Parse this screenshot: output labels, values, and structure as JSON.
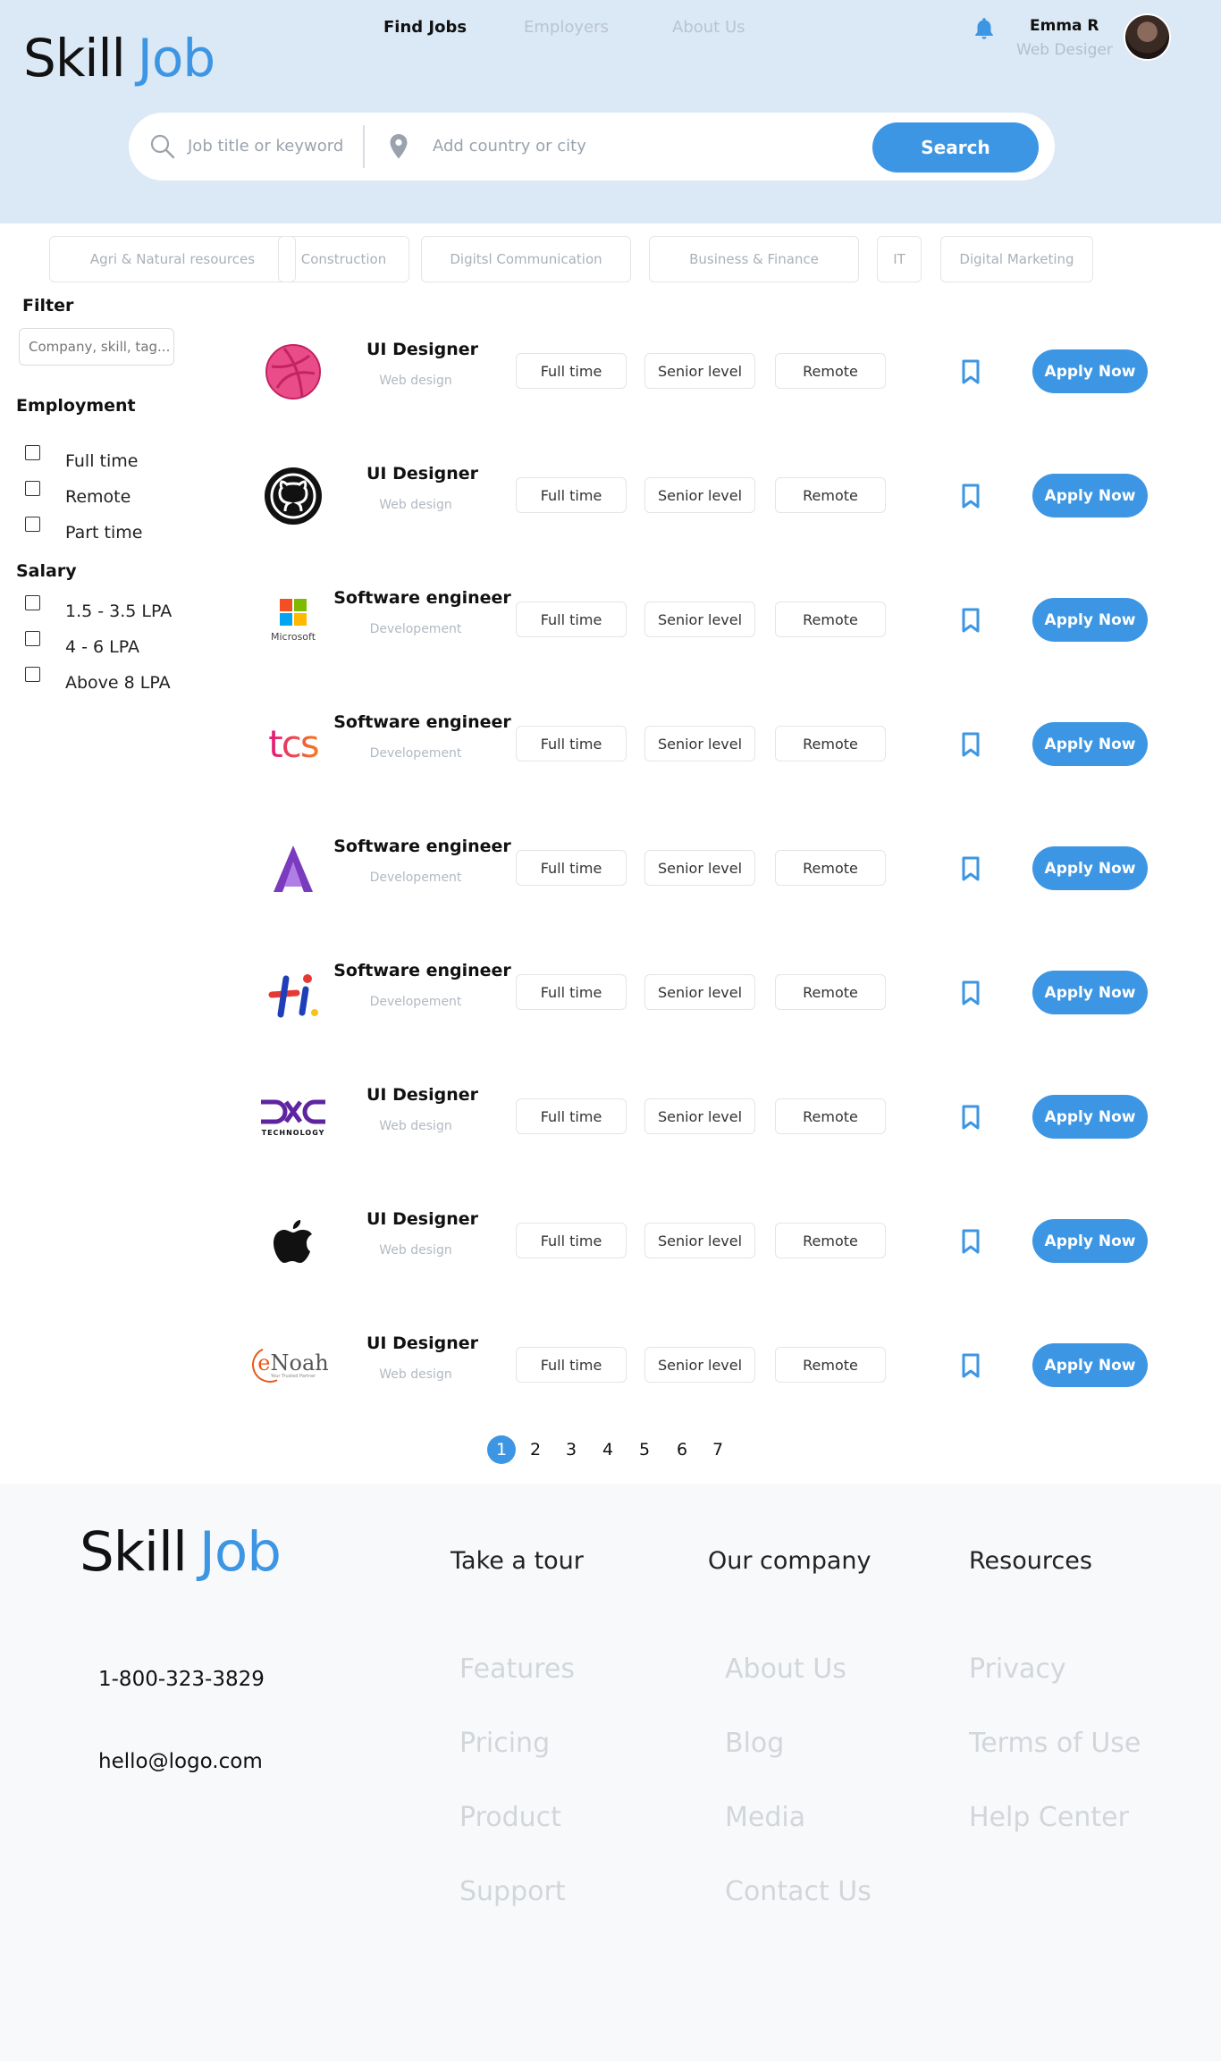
{
  "brand": {
    "part1": "Skill",
    "part2": "Job"
  },
  "nav": [
    "Find Jobs",
    "Employers",
    "About Us"
  ],
  "user": {
    "name": "Emma R",
    "role": "Web Desiger"
  },
  "search": {
    "keyword_placeholder": "Job title or keyword",
    "location_placeholder": "Add country or city",
    "button": "Search"
  },
  "categories": [
    "Agri & Natural resources",
    "Construction",
    "Digitsl Communication",
    "Business & Finance",
    "IT",
    "Digital Marketing"
  ],
  "filter": {
    "title": "Filter",
    "placeholder": "Company, skill, tag...",
    "employment_title": "Employment",
    "employment": [
      "Full time",
      "Remote",
      "Part time"
    ],
    "salary_title": "Salary",
    "salary": [
      "1.5 - 3.5 LPA",
      "4 - 6 LPA",
      "Above 8 LPA"
    ]
  },
  "jobs": [
    {
      "company_icon": "dribbble-logo",
      "title": "UI Designer",
      "category": "Web design",
      "tags": [
        "Full time",
        "Senior level",
        "Remote"
      ],
      "apply": "Apply Now"
    },
    {
      "company_icon": "github-logo",
      "title": "UI Designer",
      "category": "Web design",
      "tags": [
        "Full time",
        "Senior level",
        "Remote"
      ],
      "apply": "Apply Now"
    },
    {
      "company_icon": "microsoft-logo",
      "logo_text": "Microsoft",
      "title": "Software engineer",
      "category": "Developement",
      "tags": [
        "Full time",
        "Senior level",
        "Remote"
      ],
      "apply": "Apply Now"
    },
    {
      "company_icon": "tcs-logo",
      "logo_text": "tcs",
      "title": "Software engineer",
      "category": "Developement",
      "tags": [
        "Full time",
        "Senior level",
        "Remote"
      ],
      "apply": "Apply Now"
    },
    {
      "company_icon": "purple-a-logo",
      "title": "Software engineer",
      "category": "Developement",
      "tags": [
        "Full time",
        "Senior level",
        "Remote"
      ],
      "apply": "Apply Now"
    },
    {
      "company_icon": "hi-logo",
      "title": "Software engineer",
      "category": "Developement",
      "tags": [
        "Full time",
        "Senior level",
        "Remote"
      ],
      "apply": "Apply Now"
    },
    {
      "company_icon": "dxc-logo",
      "logo_text": "TECHNOLOGY",
      "title": "UI Designer",
      "category": "Web design",
      "tags": [
        "Full time",
        "Senior level",
        "Remote"
      ],
      "apply": "Apply Now"
    },
    {
      "company_icon": "apple-logo",
      "title": "UI Designer",
      "category": "Web design",
      "tags": [
        "Full time",
        "Senior level",
        "Remote"
      ],
      "apply": "Apply Now"
    },
    {
      "company_icon": "enoah-logo",
      "logo_text": "eNoah",
      "logo_tagline": "Your Trusted Partner",
      "title": "UI Designer",
      "category": "Web design",
      "tags": [
        "Full time",
        "Senior level",
        "Remote"
      ],
      "apply": "Apply Now"
    }
  ],
  "pagination": {
    "pages": [
      "1",
      "2",
      "3",
      "4",
      "5",
      "6",
      "7"
    ],
    "current": "1"
  },
  "footer": {
    "headings": [
      "Take a tour",
      "Our company",
      "Resources"
    ],
    "phone": "1-800-323-3829",
    "email": "hello@logo.com",
    "tour": [
      "Features",
      "Pricing",
      "Product",
      "Support"
    ],
    "company": [
      "About Us",
      "Blog",
      "Media",
      "Contact Us"
    ],
    "resources": [
      "Privacy",
      "Terms of Use",
      "Help Center"
    ]
  },
  "colors": {
    "accent": "#3d96e3",
    "hero_bg": "#dbe8f5",
    "footer_bg": "#f8f9fb"
  }
}
